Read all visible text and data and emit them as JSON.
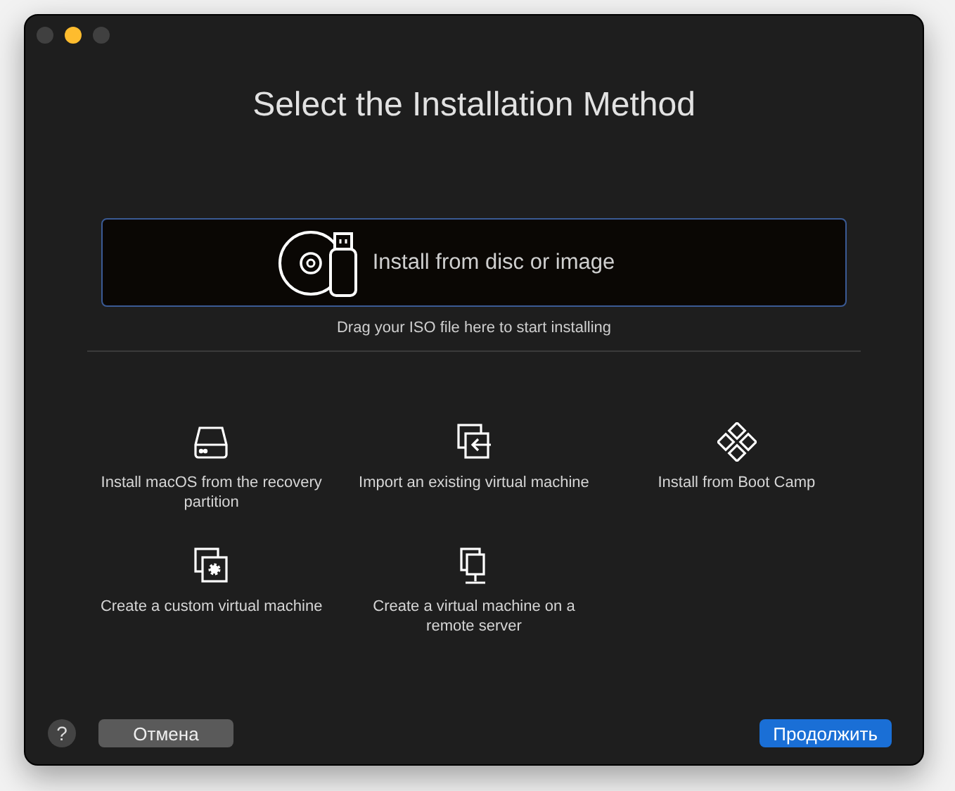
{
  "window": {
    "buttons": [
      {
        "color": "#404040"
      },
      {
        "color": "#febc2e"
      },
      {
        "color": "#404040"
      }
    ]
  },
  "title": "Select the Installation Method",
  "drop_zone": {
    "label": "Install from disc or image",
    "hint": "Drag your ISO file here to start installing"
  },
  "options": [
    {
      "kind": "drive",
      "label": "Install macOS from the recovery partition"
    },
    {
      "kind": "import",
      "label": "Import an existing virtual machine"
    },
    {
      "kind": "bootcamp",
      "label": "Install from Boot Camp"
    },
    {
      "kind": "custom",
      "label": "Create a custom virtual machine"
    },
    {
      "kind": "remote",
      "label": "Create a virtual machine on a remote server"
    }
  ],
  "footer": {
    "help": "?",
    "cancel": "Отмена",
    "continue": "Продолжить"
  }
}
